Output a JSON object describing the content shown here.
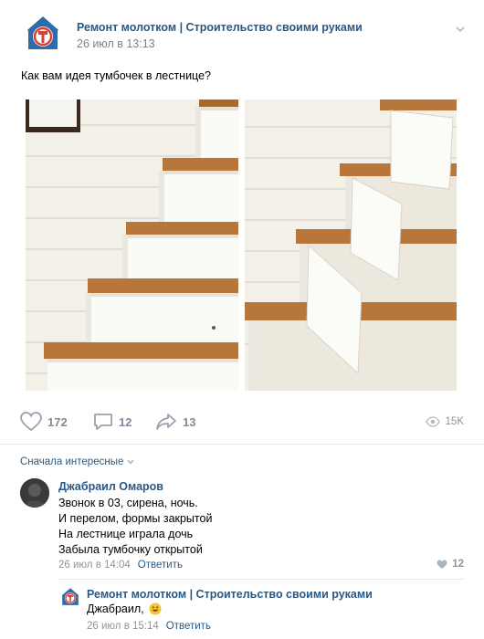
{
  "post": {
    "author": "Ремонт молотком | Строительство своими руками",
    "date": "26 июл в 13:13",
    "text": "Как вам идея тумбочек в лестнице?",
    "logo_icon": "hammer-house-logo-icon"
  },
  "actions": {
    "likes": "172",
    "comments": "12",
    "shares": "13",
    "views": "15K"
  },
  "comments_section": {
    "sort_label": "Сначала интересные"
  },
  "comment": {
    "author": "Джабраил Омаров",
    "lines": [
      "Звонок в 03, сирена, ночь.",
      "И перелом, формы закрытой",
      "На лестнице играла дочь",
      "Забыла тумбочку открытой"
    ],
    "date": "26 июл в 14:04",
    "reply_label": "Ответить",
    "likes": "12"
  },
  "reply": {
    "author": "Ремонт молотком | Строительство своими руками",
    "text": "Джабраил,",
    "date": "26 июл в 15:14",
    "reply_label": "Ответить"
  },
  "colors": {
    "link": "#2a5885",
    "meta": "#939393",
    "logo_red": "#d64236",
    "logo_blue": "#2e6ca8"
  }
}
